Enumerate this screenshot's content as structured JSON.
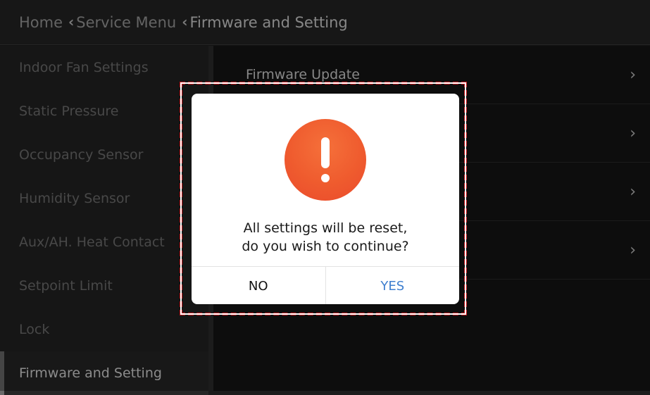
{
  "breadcrumb": {
    "home": "Home",
    "service_menu": "Service Menu",
    "current": "Firmware and Setting"
  },
  "sidebar": {
    "items": [
      {
        "label": "Indoor Fan Settings"
      },
      {
        "label": "Static Pressure"
      },
      {
        "label": "Occupancy Sensor"
      },
      {
        "label": "Humidity Sensor"
      },
      {
        "label": "Aux/AH. Heat Contact"
      },
      {
        "label": "Setpoint Limit"
      },
      {
        "label": "Lock"
      },
      {
        "label": "Firmware and Setting"
      }
    ],
    "active_index": 7
  },
  "main": {
    "rows": [
      {
        "label": "Firmware Update"
      },
      {
        "label": ""
      },
      {
        "label": ""
      },
      {
        "label": ""
      }
    ]
  },
  "dialog": {
    "icon": "alert-icon",
    "message_line1": "All settings will be reset,",
    "message_line2": "do you wish to continue?",
    "no_label": "NO",
    "yes_label": "YES",
    "accent_color": "#ef5b2e",
    "highlight_color": "#c4161c"
  }
}
